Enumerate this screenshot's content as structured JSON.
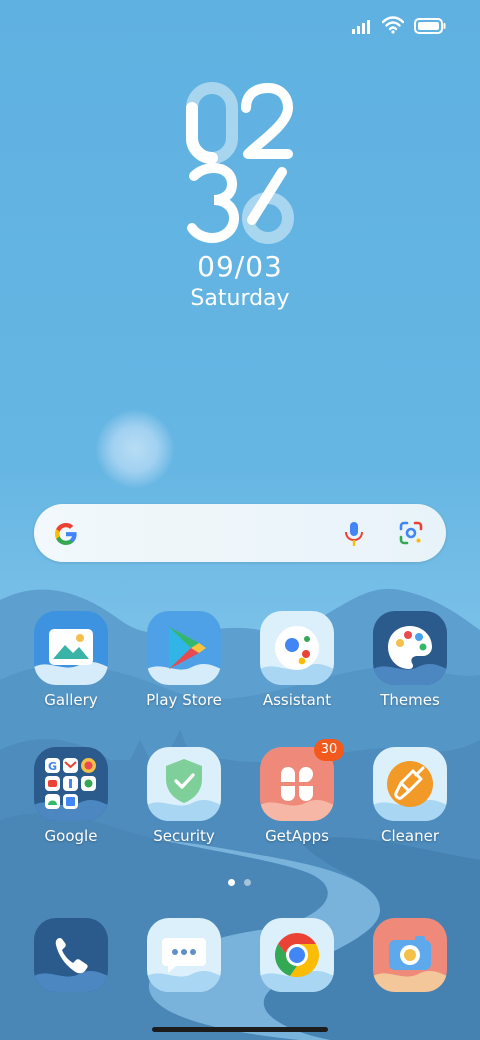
{
  "clock": {
    "hour": "02",
    "minute": "36",
    "date": "09/03",
    "day": "Saturday"
  },
  "status": {
    "signal_icon": "signal-icon",
    "wifi_icon": "wifi-icon",
    "battery_icon": "battery-icon"
  },
  "search": {
    "google_icon": "google-g-icon",
    "voice_icon": "microphone-icon",
    "lens_icon": "google-lens-icon"
  },
  "apps": [
    {
      "label": "Gallery",
      "icon": "gallery-icon"
    },
    {
      "label": "Play Store",
      "icon": "play-store-icon"
    },
    {
      "label": "Assistant",
      "icon": "assistant-icon"
    },
    {
      "label": "Themes",
      "icon": "themes-icon"
    },
    {
      "label": "Google",
      "icon": "google-folder-icon"
    },
    {
      "label": "Security",
      "icon": "security-icon"
    },
    {
      "label": "GetApps",
      "icon": "getapps-icon",
      "badge": "30"
    },
    {
      "label": "Cleaner",
      "icon": "cleaner-icon"
    }
  ],
  "dock": [
    {
      "icon": "phone-icon"
    },
    {
      "icon": "messages-icon"
    },
    {
      "icon": "chrome-icon"
    },
    {
      "icon": "camera-icon"
    }
  ],
  "pager": {
    "pages": 2,
    "active": 1
  },
  "colors": {
    "badge": "#f25a1d",
    "sky": "#66b6e3",
    "accent_blue": "#2f6fb8"
  }
}
